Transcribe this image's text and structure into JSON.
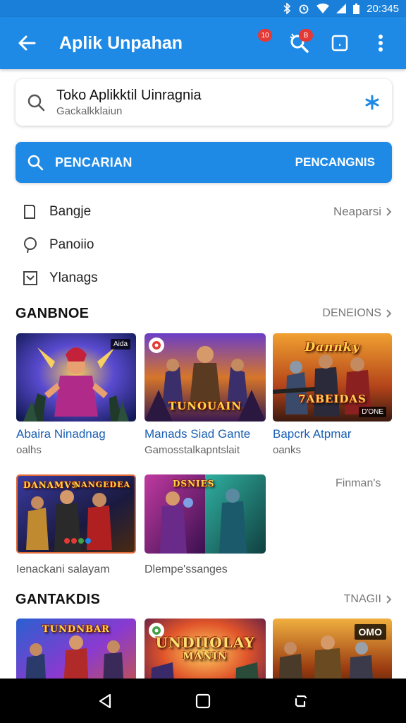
{
  "status_bar": {
    "time": "20:345"
  },
  "app_bar": {
    "title": "Aplik Unpahan",
    "badge_one": "10",
    "badge_two": "B"
  },
  "search_card": {
    "title": "Toko Aplikktil Uinragnia",
    "subtitle": "Gackalkklaiun"
  },
  "search_button": {
    "label": "PENCARIAN",
    "right_label": "PENCANGNIS"
  },
  "filters": [
    {
      "label": "Bangje",
      "right": "Neaparsi"
    },
    {
      "label": "Panoiio",
      "right": ""
    },
    {
      "label": "Ylanags",
      "right": ""
    }
  ],
  "section_one": {
    "title": "GANBNOE",
    "link": "DENEIONS",
    "row_one": [
      {
        "title": "Abaira Ninadnag",
        "subtitle": "oalhs",
        "tag": "Aida"
      },
      {
        "title": "Manads Siad Gante",
        "subtitle": "Gamosstalkapntslait",
        "tag": "",
        "art_text": "TUNOUAIN"
      },
      {
        "title": "Bapcrk Atpmar",
        "subtitle": "oanks",
        "tag": "D'ONE",
        "art_text": "Dannky",
        "art_text_two": "7ABEIDAS"
      }
    ],
    "row_two": [
      {
        "caption": "Ienackani salayam",
        "art_text": "DANAMVS",
        "art_text_two": "NANGEDEA"
      },
      {
        "caption": "Dlempe'ssanges",
        "art_text": "DSNIES"
      }
    ],
    "side_link": "Finman's"
  },
  "section_two": {
    "title": "GANTAKDIS",
    "link": "TNAGII",
    "tiles": [
      {
        "art_text": "TUNDNBAR"
      },
      {
        "art_text": "UNDIIOLAY",
        "art_text_two": "MANIN"
      },
      {
        "tag": "OMO"
      }
    ]
  },
  "colors": {
    "primary": "#1e8ae6",
    "status_bar": "#1a7fd8",
    "link_text": "#1a5fb4"
  }
}
